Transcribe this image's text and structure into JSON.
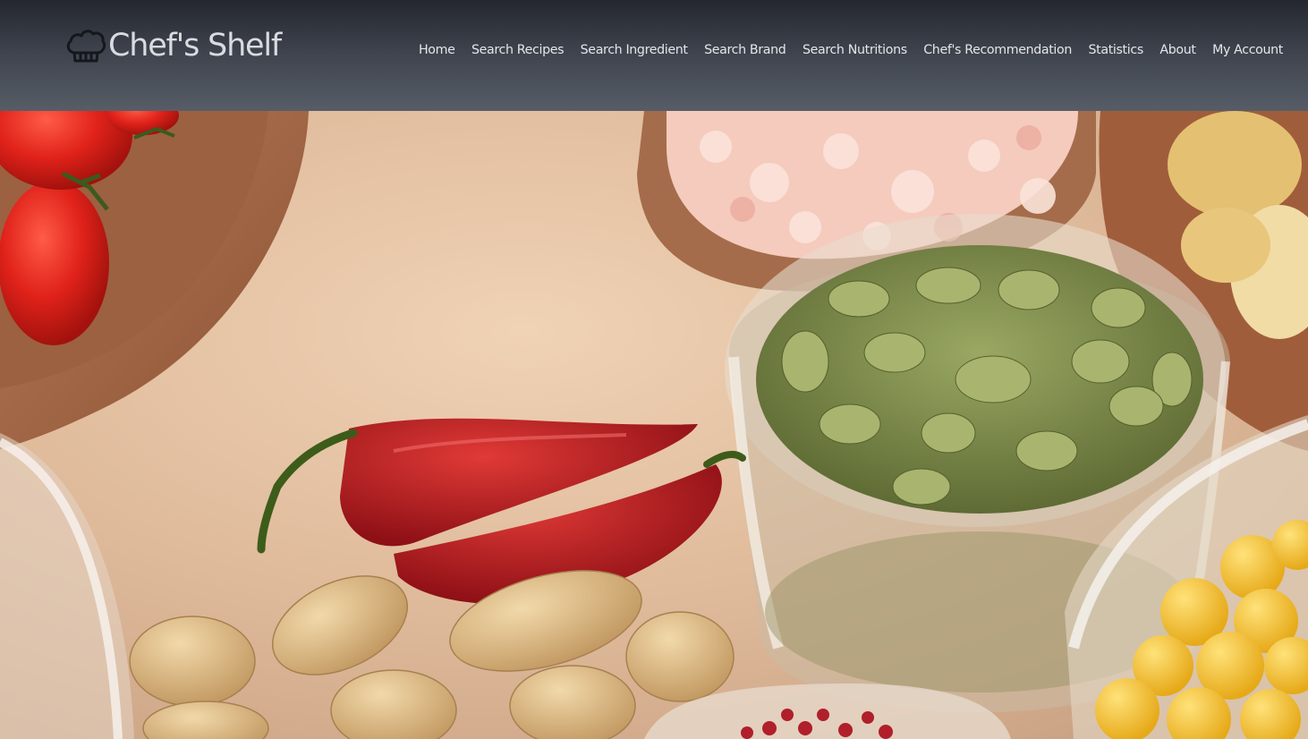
{
  "brand": {
    "name": "Chef's Shelf",
    "logo_icon": "chef-hat-icon"
  },
  "nav": {
    "items": [
      {
        "label": "Home"
      },
      {
        "label": "Search Recipes"
      },
      {
        "label": "Search Ingredient"
      },
      {
        "label": "Search Brand"
      },
      {
        "label": "Search Nutritions"
      },
      {
        "label": "Chef's Recommendation"
      },
      {
        "label": "Statistics"
      },
      {
        "label": "About"
      },
      {
        "label": "My Account"
      }
    ]
  },
  "colors": {
    "header_top": "#24272f",
    "header_bottom": "#575d67",
    "nav_text": "#e4e6ea",
    "hero_background": "#d8b89a"
  }
}
